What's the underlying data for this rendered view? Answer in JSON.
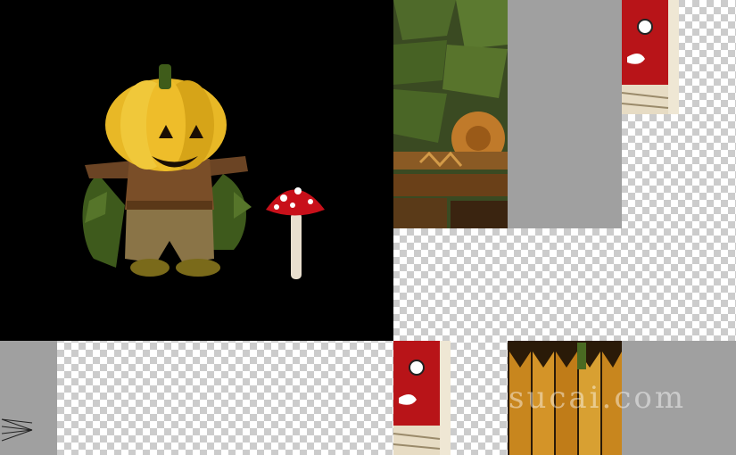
{
  "watermark": {
    "text": "sucai.com"
  },
  "icons": {
    "pumpkin": "pumpkin-scarecrow-character-icon",
    "mushroom": "mushroom-icon",
    "axis": "axis-gizmo-icon"
  },
  "colors": {
    "viewport_bg": "#000000",
    "gray_panel": "#a0a0a0",
    "pumpkin_yellow": "#e8b826",
    "mushroom_red": "#c8101a",
    "banner_red": "#b81418",
    "fence_orange": "#c8861e"
  }
}
